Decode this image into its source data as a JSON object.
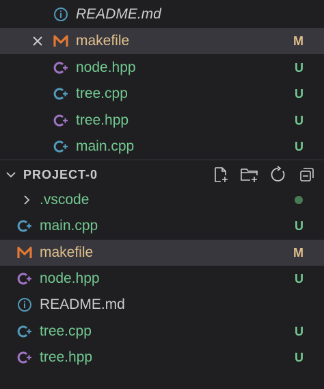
{
  "colors": {
    "modified": "#e2c08d",
    "untracked": "#73c991",
    "default_text": "#cccccc",
    "cpp_icon": "#519aba",
    "hpp_icon": "#a074c4",
    "makefile_icon": "#e37933",
    "info_icon": "#519aba",
    "dot": "#4a7a55"
  },
  "open_editors": [
    {
      "name": "README.md",
      "icon": "info-icon",
      "status": ""
    },
    {
      "name": "makefile",
      "icon": "makefile-icon",
      "status": "M"
    },
    {
      "name": "node.hpp",
      "icon": "cpp-header-icon",
      "status": "U"
    },
    {
      "name": "tree.cpp",
      "icon": "cpp-source-icon",
      "status": "U"
    },
    {
      "name": "tree.hpp",
      "icon": "cpp-header-icon",
      "status": "U"
    },
    {
      "name": "main.cpp",
      "icon": "cpp-source-icon",
      "status": "U"
    }
  ],
  "project": {
    "title": "PROJECT-0",
    "toolbar": [
      "new-file-icon",
      "new-folder-icon",
      "refresh-icon",
      "collapse-all-icon"
    ],
    "folder": {
      "name": ".vscode",
      "icon": "chevron-right-icon"
    },
    "files": [
      {
        "name": "main.cpp",
        "icon": "cpp-source-icon",
        "status": "U"
      },
      {
        "name": "makefile",
        "icon": "makefile-icon",
        "status": "M"
      },
      {
        "name": "node.hpp",
        "icon": "cpp-header-icon",
        "status": "U"
      },
      {
        "name": "README.md",
        "icon": "info-icon",
        "status": ""
      },
      {
        "name": "tree.cpp",
        "icon": "cpp-source-icon",
        "status": "U"
      },
      {
        "name": "tree.hpp",
        "icon": "cpp-header-icon",
        "status": "U"
      }
    ]
  }
}
